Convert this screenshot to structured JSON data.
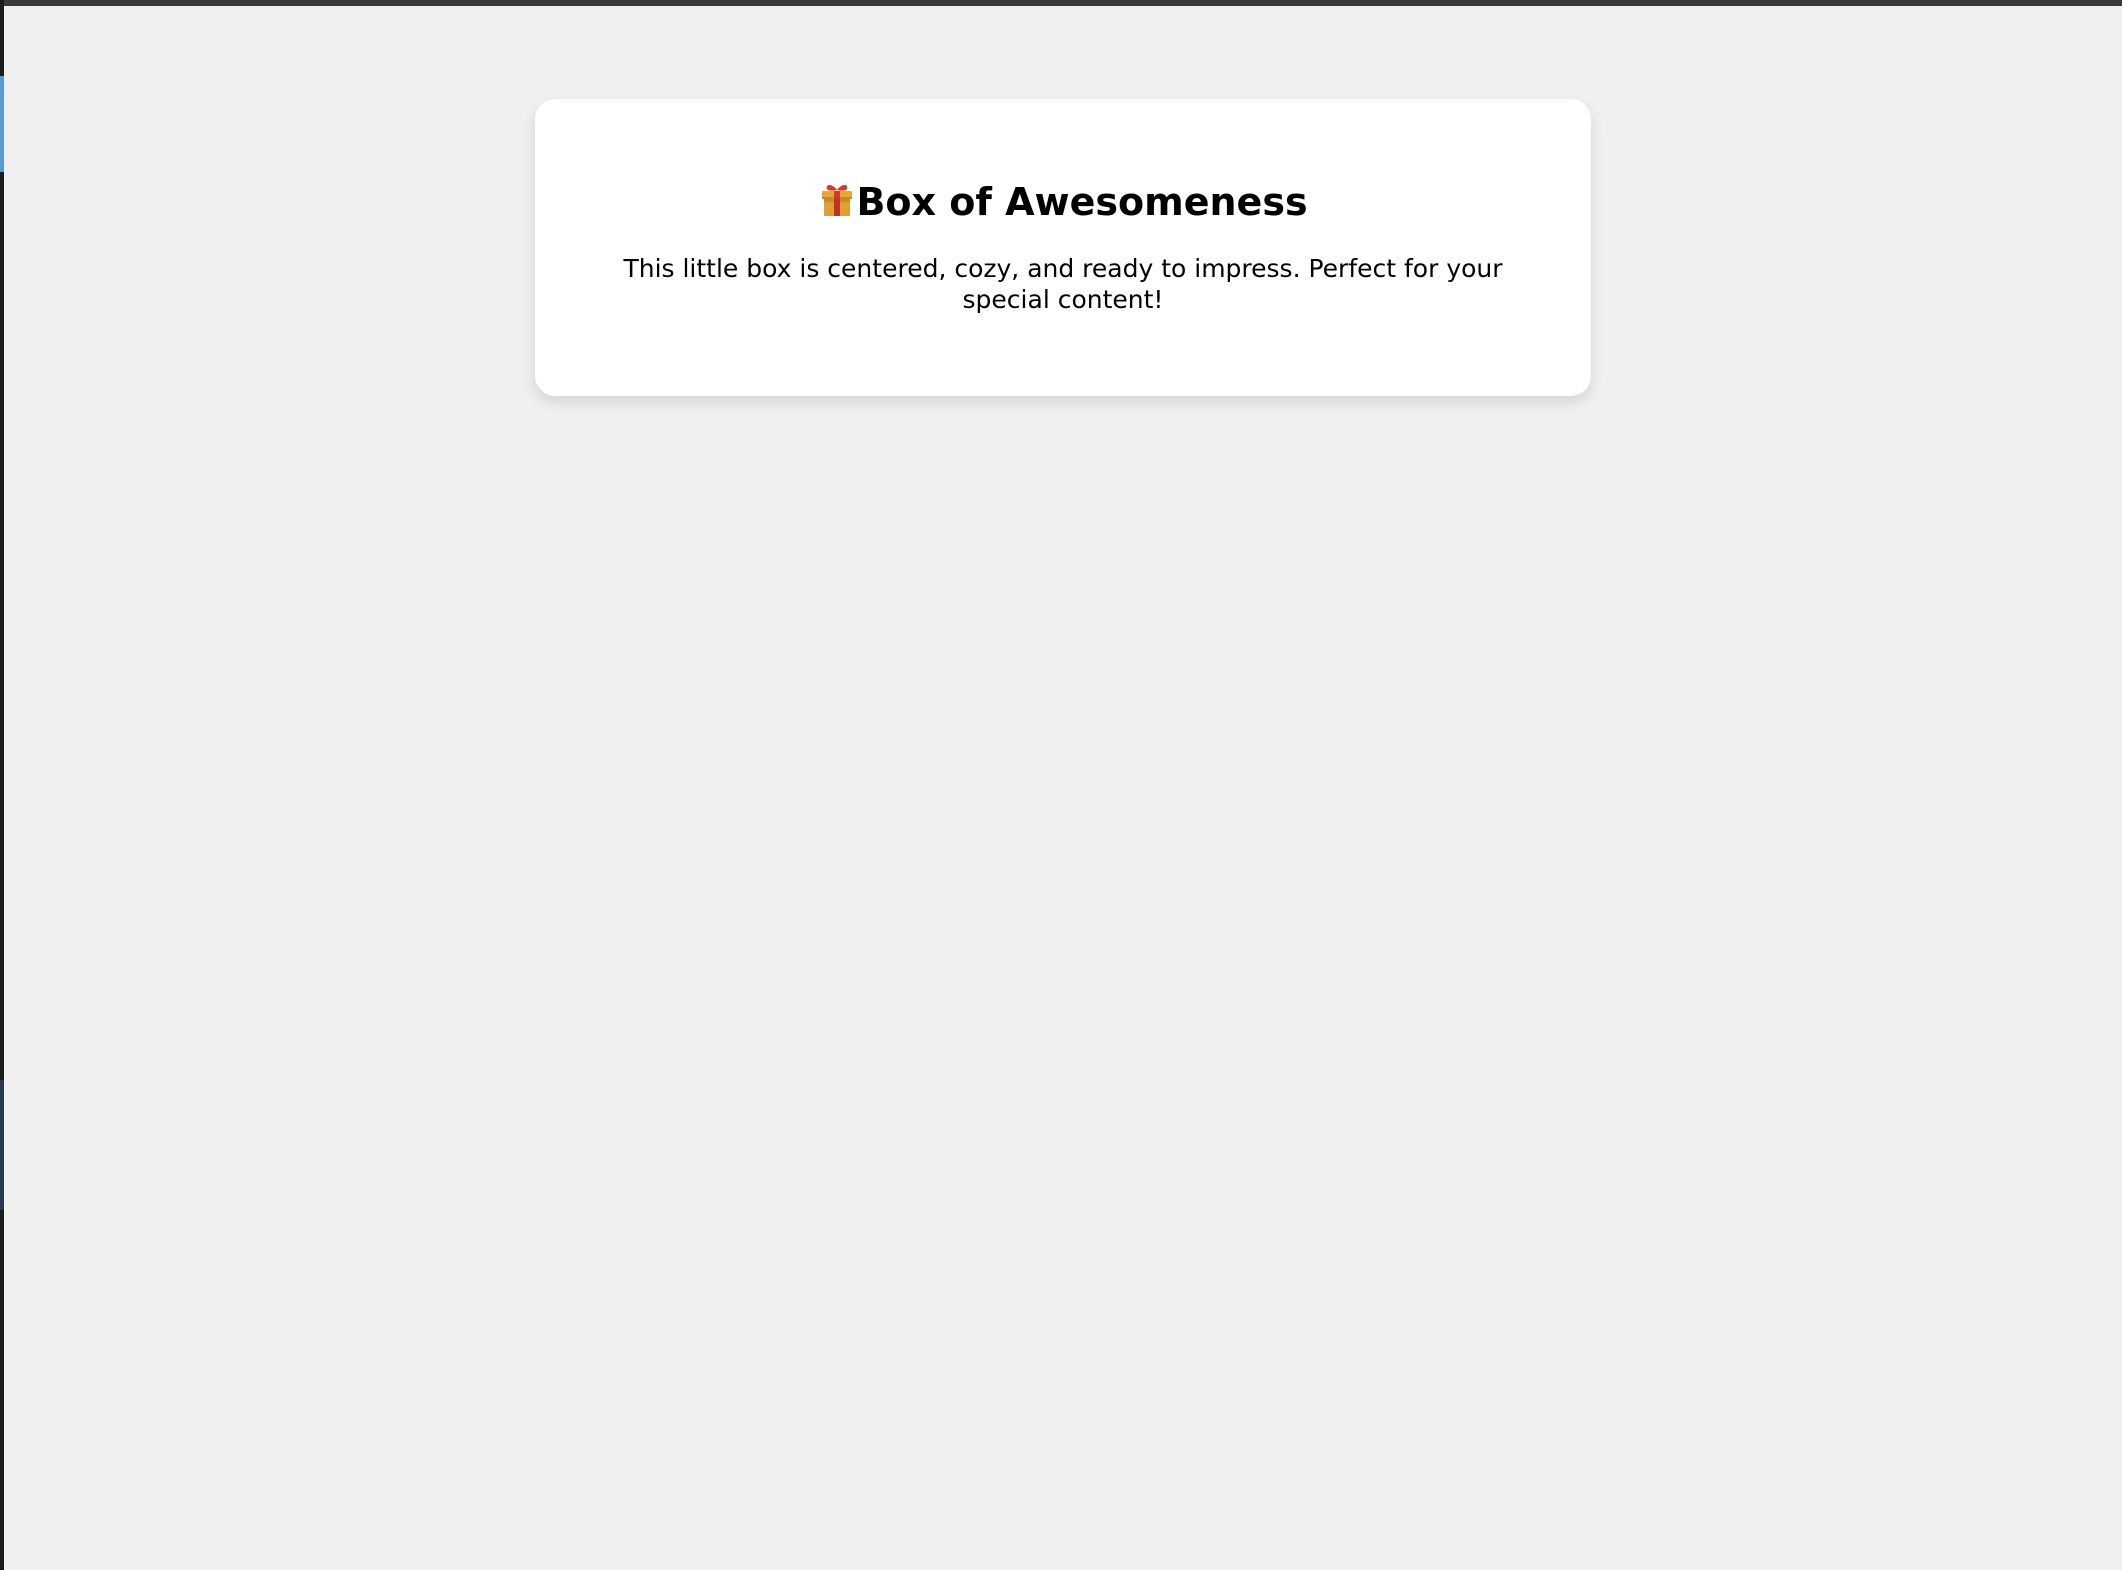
{
  "card": {
    "icon": "gift-icon",
    "title": "Box of Awesomeness",
    "description": "This little box is centered, cozy, and ready to impress. Perfect for your special content!"
  },
  "colors": {
    "page_background": "#f0f0f0",
    "card_background": "#ffffff",
    "text": "#000000",
    "gift_box": "#e0a030",
    "gift_ribbon": "#c0302a"
  }
}
